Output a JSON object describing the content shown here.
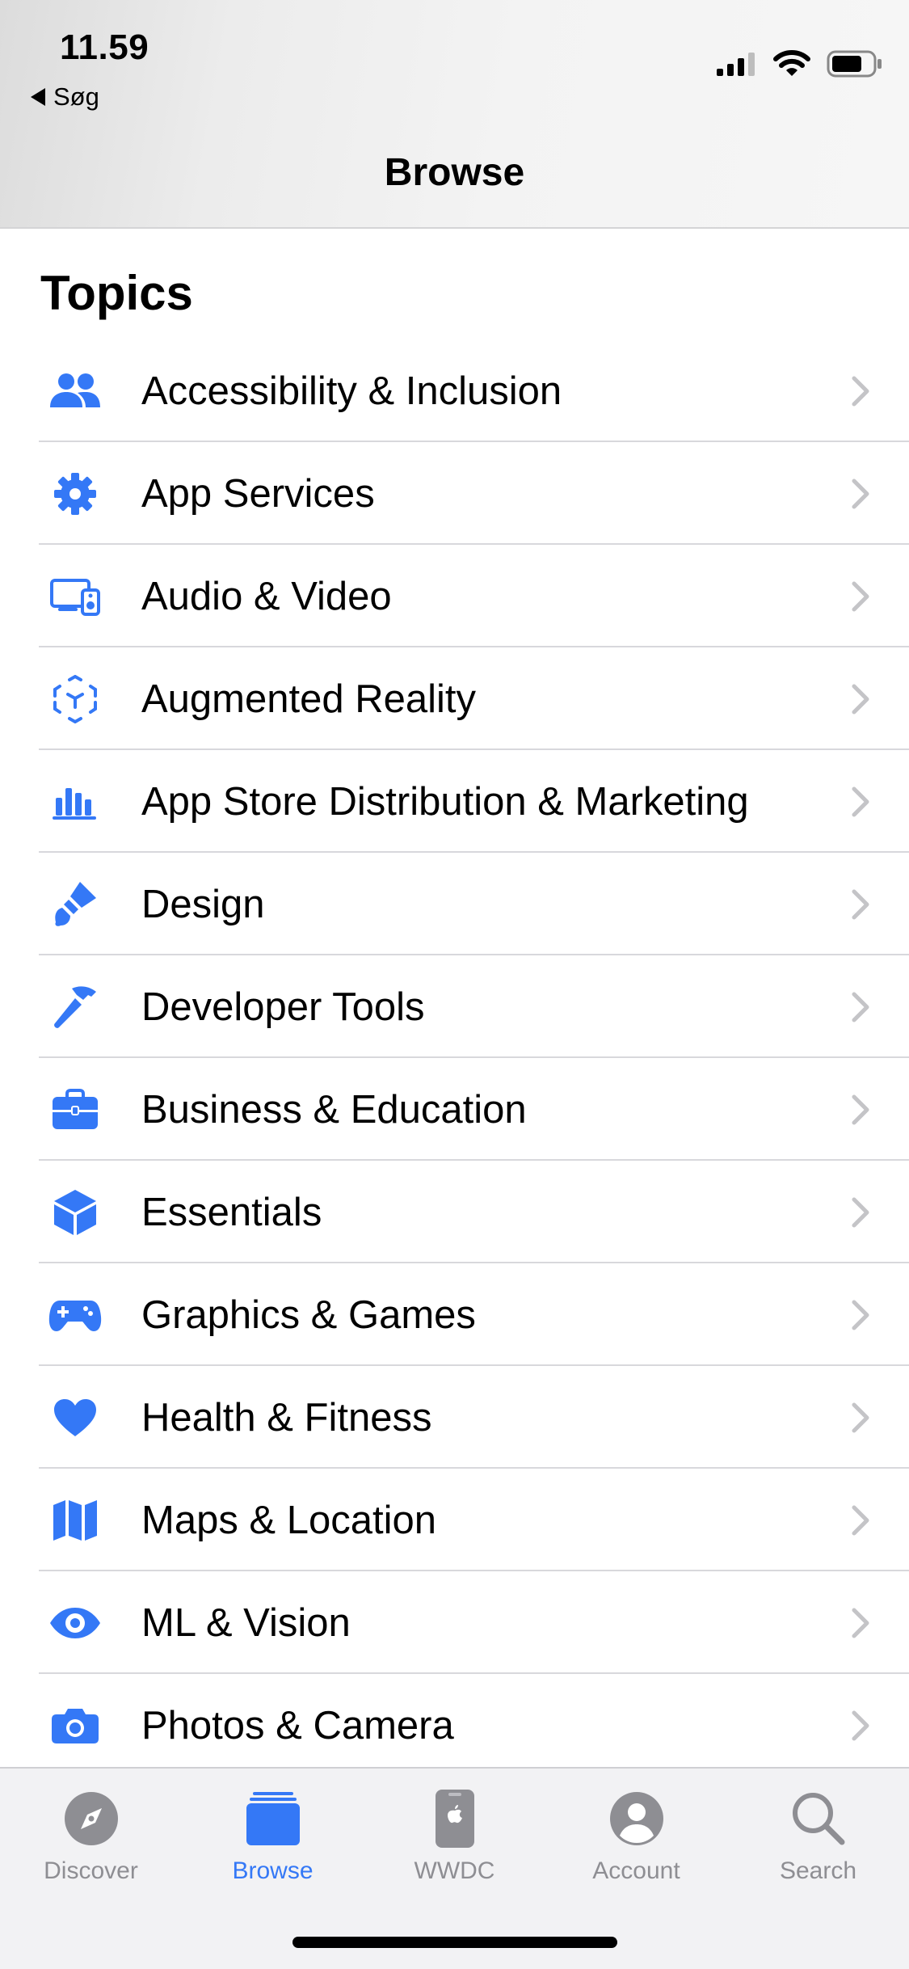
{
  "status": {
    "time": "11.59",
    "back_label": "Søg"
  },
  "nav": {
    "title": "Browse"
  },
  "section": {
    "title": "Topics"
  },
  "topics": [
    {
      "label": "Accessibility & Inclusion",
      "icon": "people-icon"
    },
    {
      "label": "App Services",
      "icon": "gear-icon"
    },
    {
      "label": "Audio & Video",
      "icon": "display-speaker-icon"
    },
    {
      "label": "Augmented Reality",
      "icon": "ar-cube-icon"
    },
    {
      "label": "App Store Distribution & Marketing",
      "icon": "bar-chart-icon"
    },
    {
      "label": "Design",
      "icon": "paintbrush-icon"
    },
    {
      "label": "Developer Tools",
      "icon": "hammer-icon"
    },
    {
      "label": "Business & Education",
      "icon": "briefcase-icon"
    },
    {
      "label": "Essentials",
      "icon": "cube-icon"
    },
    {
      "label": "Graphics & Games",
      "icon": "gamecontroller-icon"
    },
    {
      "label": "Health & Fitness",
      "icon": "heart-icon"
    },
    {
      "label": "Maps & Location",
      "icon": "map-icon"
    },
    {
      "label": "ML & Vision",
      "icon": "eye-icon"
    },
    {
      "label": "Photos & Camera",
      "icon": "camera-icon"
    }
  ],
  "tabs": [
    {
      "label": "Discover",
      "icon": "compass-icon",
      "active": false
    },
    {
      "label": "Browse",
      "icon": "stack-icon",
      "active": true
    },
    {
      "label": "WWDC",
      "icon": "wwdc-device-icon",
      "active": false
    },
    {
      "label": "Account",
      "icon": "person-circle-icon",
      "active": false
    },
    {
      "label": "Search",
      "icon": "magnifier-icon",
      "active": false
    }
  ],
  "colors": {
    "accent": "#3478f6",
    "inactive": "#8e8e93",
    "chevron": "#c4c4c7"
  }
}
